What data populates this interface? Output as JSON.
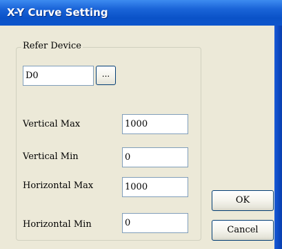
{
  "window": {
    "title": "X-Y Curve Setting"
  },
  "refer_device": {
    "group_label": "Refer Device",
    "device_value": "D0",
    "browse_label": "..."
  },
  "fields": {
    "vertical_max": {
      "label": "Vertical Max",
      "value": "1000"
    },
    "vertical_min": {
      "label": "Vertical Min",
      "value": "0"
    },
    "horizontal_max": {
      "label": "Horizontal Max",
      "value": "1000"
    },
    "horizontal_min": {
      "label": "Horizontal Min",
      "value": "0"
    }
  },
  "buttons": {
    "ok": "OK",
    "cancel": "Cancel"
  }
}
